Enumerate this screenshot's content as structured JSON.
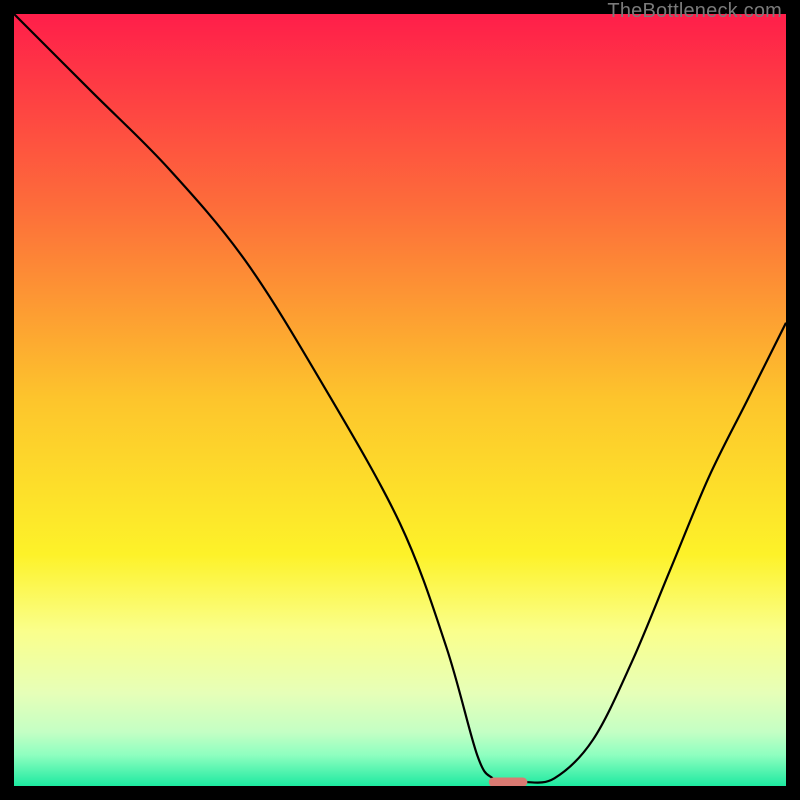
{
  "watermark": "TheBottleneck.com",
  "chart_data": {
    "type": "line",
    "title": "",
    "xlabel": "",
    "ylabel": "",
    "xlim": [
      0,
      100
    ],
    "ylim": [
      0,
      100
    ],
    "grid": false,
    "legend": false,
    "background_gradient": {
      "stops": [
        {
          "offset": 0,
          "color": "#ff1e4a"
        },
        {
          "offset": 25,
          "color": "#fd6d3a"
        },
        {
          "offset": 50,
          "color": "#fdc52c"
        },
        {
          "offset": 70,
          "color": "#fdf229"
        },
        {
          "offset": 80,
          "color": "#faff8c"
        },
        {
          "offset": 88,
          "color": "#e6ffb8"
        },
        {
          "offset": 93,
          "color": "#c4ffc4"
        },
        {
          "offset": 96,
          "color": "#8effc0"
        },
        {
          "offset": 100,
          "color": "#1de9a0"
        }
      ]
    },
    "series": [
      {
        "name": "bottleneck-curve",
        "color": "#000000",
        "x": [
          0,
          10,
          20,
          30,
          40,
          50,
          56,
          60,
          62,
          64,
          66,
          70,
          75,
          80,
          85,
          90,
          95,
          100
        ],
        "y": [
          100,
          90,
          80,
          68,
          52,
          34,
          18,
          4,
          1,
          0.5,
          0.5,
          1,
          6,
          16,
          28,
          40,
          50,
          60
        ]
      }
    ],
    "marker": {
      "color": "#d97a72",
      "x": 64,
      "y": 0.5,
      "width": 5,
      "height": 1.2,
      "shape": "pill"
    }
  }
}
